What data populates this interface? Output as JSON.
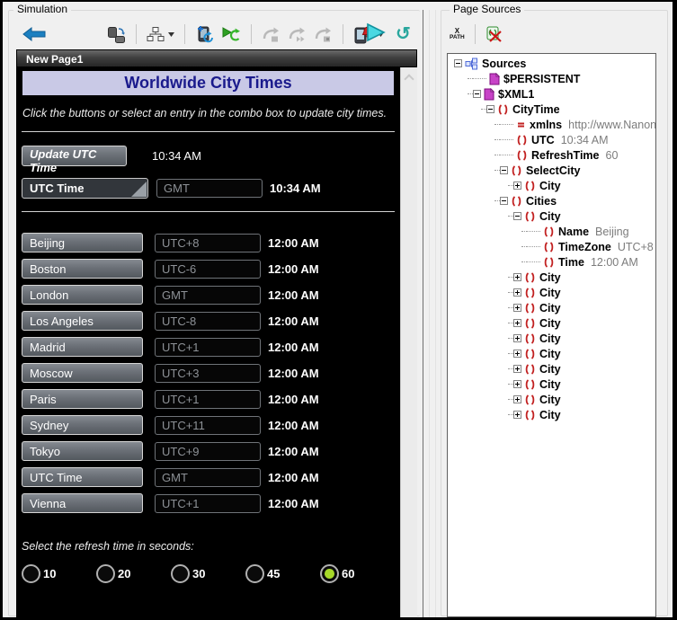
{
  "simulation": {
    "panel_title": "Simulation",
    "toolbar_icons": [
      "back-arrow-icon",
      "page-transition-icon",
      "page-structure-icon",
      "dropdown-caret-icon",
      "device-refresh-icon",
      "restart-simulation-icon",
      "server-step-1-icon",
      "server-step-2-icon",
      "server-step-3-icon",
      "device-notification-icon",
      "dropdown-caret-icon",
      "run-icon",
      "reload-icon"
    ],
    "page": {
      "title": "New Page1",
      "banner": "Worldwide City Times",
      "instruction": "Click the buttons or select an entry in the combo box to update city times.",
      "update_button_label": "Update UTC Time",
      "utc_time": "10:34 AM",
      "combo": {
        "label": "UTC Time",
        "zone": "GMT",
        "time": "10:34 AM"
      },
      "cities": [
        {
          "name": "Beijing",
          "zone": "UTC+8",
          "time": "12:00 AM"
        },
        {
          "name": "Boston",
          "zone": "UTC-6",
          "time": "12:00 AM"
        },
        {
          "name": "London",
          "zone": "GMT",
          "time": "12:00 AM"
        },
        {
          "name": "Los Angeles",
          "zone": "UTC-8",
          "time": "12:00 AM"
        },
        {
          "name": "Madrid",
          "zone": "UTC+1",
          "time": "12:00 AM"
        },
        {
          "name": "Moscow",
          "zone": "UTC+3",
          "time": "12:00 AM"
        },
        {
          "name": "Paris",
          "zone": "UTC+1",
          "time": "12:00 AM"
        },
        {
          "name": "Sydney",
          "zone": "UTC+11",
          "time": "12:00 AM"
        },
        {
          "name": "Tokyo",
          "zone": "UTC+9",
          "time": "12:00 AM"
        },
        {
          "name": "UTC Time",
          "zone": "GMT",
          "time": "12:00 AM"
        },
        {
          "name": "Vienna",
          "zone": "UTC+1",
          "time": "12:00 AM"
        }
      ],
      "refresh_prompt": "Select the refresh time in seconds:",
      "refresh_options": [
        {
          "label": "10",
          "selected": false
        },
        {
          "label": "20",
          "selected": false
        },
        {
          "label": "30",
          "selected": false
        },
        {
          "label": "45",
          "selected": false
        },
        {
          "label": "60",
          "selected": true
        }
      ],
      "colors": {
        "page_bg": "#000000",
        "banner_bg": "#c9c9e6",
        "banner_text": "#1a1a8c",
        "selected_radio": "#a6d829"
      }
    }
  },
  "page_sources": {
    "panel_title": "Page Sources",
    "toolbar": {
      "xpath_top": "X",
      "xpath_bottom": "PATH",
      "icons": [
        "xpath-icon",
        "remove-source-icon"
      ]
    },
    "tree": [
      {
        "depth": 0,
        "expander": "minus",
        "icon": "sources",
        "label": "Sources",
        "value": ""
      },
      {
        "depth": 1,
        "expander": null,
        "icon": "page",
        "label": "$PERSISTENT",
        "value": ""
      },
      {
        "depth": 1,
        "expander": "minus",
        "icon": "page",
        "label": "$XML1",
        "value": ""
      },
      {
        "depth": 2,
        "expander": "minus",
        "icon": "elem",
        "label": "CityTime",
        "value": ""
      },
      {
        "depth": 3,
        "expander": null,
        "icon": "eq",
        "label": "xmlns",
        "value": "http://www.Nanonull.com/T"
      },
      {
        "depth": 3,
        "expander": null,
        "icon": "elem",
        "label": "UTC",
        "value": "10:34 AM"
      },
      {
        "depth": 3,
        "expander": null,
        "icon": "elem",
        "label": "RefreshTime",
        "value": "60"
      },
      {
        "depth": 3,
        "expander": "minus",
        "icon": "elem",
        "label": "SelectCity",
        "value": ""
      },
      {
        "depth": 4,
        "expander": "plus",
        "icon": "elem",
        "label": "City",
        "value": ""
      },
      {
        "depth": 3,
        "expander": "minus",
        "icon": "elem",
        "label": "Cities",
        "value": ""
      },
      {
        "depth": 4,
        "expander": "minus",
        "icon": "elem",
        "label": "City",
        "value": ""
      },
      {
        "depth": 5,
        "expander": null,
        "icon": "elem",
        "label": "Name",
        "value": "Beijing"
      },
      {
        "depth": 5,
        "expander": null,
        "icon": "elem",
        "label": "TimeZone",
        "value": "UTC+8"
      },
      {
        "depth": 5,
        "expander": null,
        "icon": "elem",
        "label": "Time",
        "value": "12:00 AM"
      },
      {
        "depth": 4,
        "expander": "plus",
        "icon": "elem",
        "label": "City",
        "value": ""
      },
      {
        "depth": 4,
        "expander": "plus",
        "icon": "elem",
        "label": "City",
        "value": ""
      },
      {
        "depth": 4,
        "expander": "plus",
        "icon": "elem",
        "label": "City",
        "value": ""
      },
      {
        "depth": 4,
        "expander": "plus",
        "icon": "elem",
        "label": "City",
        "value": ""
      },
      {
        "depth": 4,
        "expander": "plus",
        "icon": "elem",
        "label": "City",
        "value": ""
      },
      {
        "depth": 4,
        "expander": "plus",
        "icon": "elem",
        "label": "City",
        "value": ""
      },
      {
        "depth": 4,
        "expander": "plus",
        "icon": "elem",
        "label": "City",
        "value": ""
      },
      {
        "depth": 4,
        "expander": "plus",
        "icon": "elem",
        "label": "City",
        "value": ""
      },
      {
        "depth": 4,
        "expander": "plus",
        "icon": "elem",
        "label": "City",
        "value": ""
      },
      {
        "depth": 4,
        "expander": "plus",
        "icon": "elem",
        "label": "City",
        "value": ""
      }
    ]
  }
}
